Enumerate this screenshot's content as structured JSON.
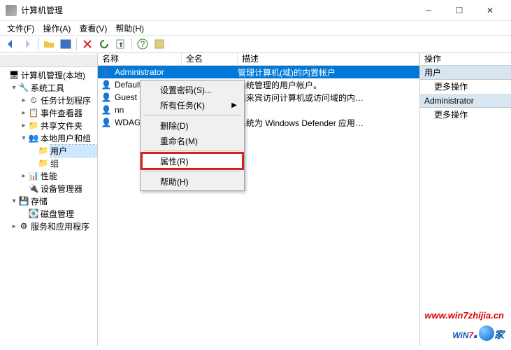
{
  "window": {
    "title": "计算机管理"
  },
  "menubar": {
    "file": "文件(F)",
    "action": "操作(A)",
    "view": "查看(V)",
    "help": "帮助(H)"
  },
  "tree": {
    "header": " ",
    "root": "计算机管理(本地)",
    "sys_tools": "系统工具",
    "task_sched": "任务计划程序",
    "event_viewer": "事件查看器",
    "shared_folders": "共享文件夹",
    "local_users": "本地用户和组",
    "users": "用户",
    "groups": "组",
    "perf": "性能",
    "devmgr": "设备管理器",
    "storage": "存储",
    "diskmgmt": "磁盘管理",
    "services": "服务和应用程序"
  },
  "columns": {
    "name": "名称",
    "fullname": "全名",
    "desc": "描述"
  },
  "rows": [
    {
      "name": "Administrator",
      "full": "",
      "desc": "管理计算机(域)的内置帐户"
    },
    {
      "name": "DefaultAccount",
      "full": "",
      "desc": "系统管理的用户帐户。"
    },
    {
      "name": "Guest",
      "full": "",
      "desc": "供来宾访问计算机或访问域的内…"
    },
    {
      "name": "nn",
      "full": "",
      "desc": ""
    },
    {
      "name": "WDAGUtilityAccount",
      "full": "",
      "desc": "系统为 Windows Defender 应用…"
    }
  ],
  "context_menu": {
    "set_password": "设置密码(S)...",
    "all_tasks": "所有任务(K)",
    "delete": "删除(D)",
    "rename": "重命名(M)",
    "properties": "属性(R)",
    "help": "帮助(H)"
  },
  "actions": {
    "header": "操作",
    "sec1": "用户",
    "more1": "更多操作",
    "sec2": "Administrator",
    "more2": "更多操作"
  },
  "watermark": {
    "url": "www.win7zhijia.cn",
    "logo_prefix": "WiN",
    "logo_7": "7",
    "logo_suffix": "家"
  }
}
